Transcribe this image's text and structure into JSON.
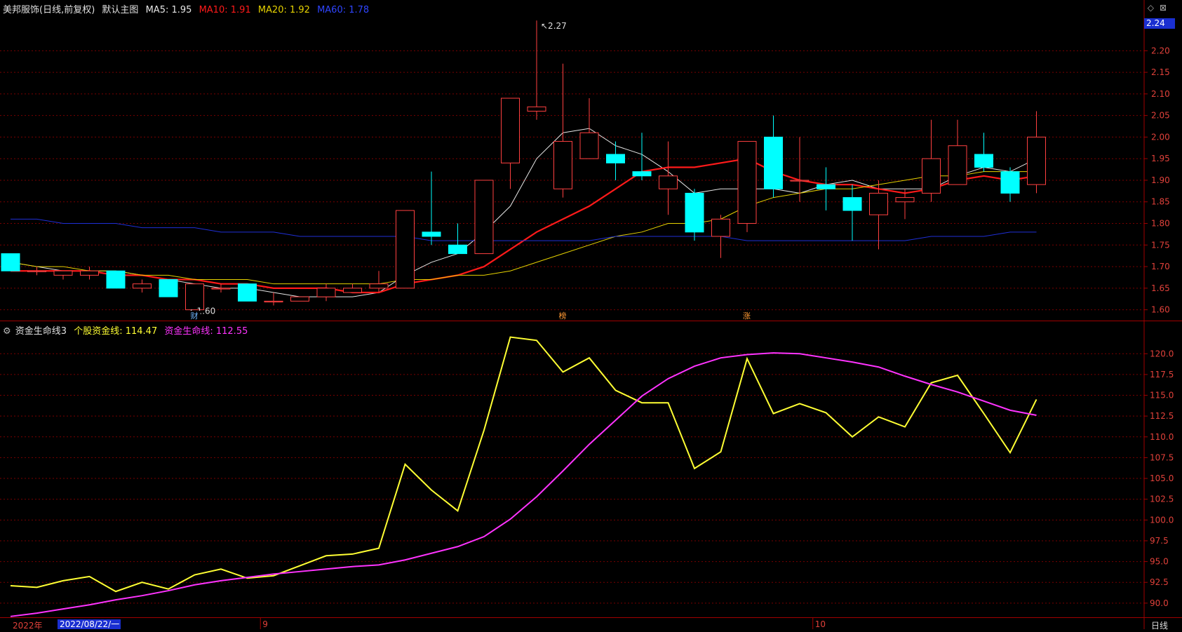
{
  "header": {
    "stock_name": "美邦服饰(日线,前复权)",
    "main_chart_label": "默认主图",
    "ma5_label": "MA5: 1.95",
    "ma10_label": "MA10: 1.91",
    "ma20_label": "MA20: 1.92",
    "ma60_label": "MA60: 1.78"
  },
  "indicator_header": {
    "name": "资金生命线3",
    "line1_label": "个股资金线: 114.47",
    "line2_label": "资金生命线: 112.55"
  },
  "current_price_badge": "2.24",
  "period_label": "日线",
  "date_axis": {
    "year_label": "2022年",
    "cursor_date": "2022/08/22/一",
    "month_labels": [
      {
        "label": "9",
        "index": 10
      },
      {
        "label": "10",
        "index": 31
      }
    ]
  },
  "markers": [
    {
      "text": "财",
      "index": 7
    },
    {
      "text": "榜",
      "index": 21
    },
    {
      "text": "涨",
      "index": 28
    }
  ],
  "annotations": {
    "high_label": "2.27",
    "low_label": "1.60"
  },
  "colors": {
    "up": "#ff4040",
    "down": "#00ffff",
    "ma5": "#e6e6e6",
    "ma10": "#ff1a1a",
    "ma20": "#e6d200",
    "ma60": "#1f2fd6",
    "fund_line": "#ffff33",
    "life_line": "#ff33ff",
    "grid": "#7a0000",
    "axis_text": "#e0413a",
    "border": "#a00000"
  },
  "chart_data": [
    {
      "type": "candlestick",
      "title": "美邦服饰(日线,前复权)",
      "y_ticks": [
        1.6,
        1.65,
        1.7,
        1.75,
        1.8,
        1.85,
        1.9,
        1.95,
        2.0,
        2.05,
        2.1,
        2.15,
        2.2
      ],
      "ylim": [
        1.575,
        2.285
      ],
      "candles": [
        {
          "o": 1.73,
          "h": 1.73,
          "l": 1.69,
          "c": 1.69
        },
        {
          "o": 1.69,
          "h": 1.7,
          "l": 1.68,
          "c": 1.69
        },
        {
          "o": 1.68,
          "h": 1.69,
          "l": 1.67,
          "c": 1.69
        },
        {
          "o": 1.68,
          "h": 1.7,
          "l": 1.67,
          "c": 1.69
        },
        {
          "o": 1.69,
          "h": 1.69,
          "l": 1.65,
          "c": 1.65
        },
        {
          "o": 1.65,
          "h": 1.67,
          "l": 1.64,
          "c": 1.66
        },
        {
          "o": 1.67,
          "h": 1.67,
          "l": 1.63,
          "c": 1.63
        },
        {
          "o": 1.6,
          "h": 1.66,
          "l": 1.6,
          "c": 1.66
        },
        {
          "o": 1.65,
          "h": 1.66,
          "l": 1.64,
          "c": 1.65
        },
        {
          "o": 1.66,
          "h": 1.66,
          "l": 1.62,
          "c": 1.62
        },
        {
          "o": 1.62,
          "h": 1.64,
          "l": 1.61,
          "c": 1.62
        },
        {
          "o": 1.62,
          "h": 1.63,
          "l": 1.62,
          "c": 1.63
        },
        {
          "o": 1.63,
          "h": 1.66,
          "l": 1.62,
          "c": 1.65
        },
        {
          "o": 1.64,
          "h": 1.66,
          "l": 1.64,
          "c": 1.65
        },
        {
          "o": 1.65,
          "h": 1.69,
          "l": 1.64,
          "c": 1.66
        },
        {
          "o": 1.65,
          "h": 1.83,
          "l": 1.65,
          "c": 1.83
        },
        {
          "o": 1.78,
          "h": 1.92,
          "l": 1.75,
          "c": 1.77
        },
        {
          "o": 1.75,
          "h": 1.8,
          "l": 1.73,
          "c": 1.73
        },
        {
          "o": 1.73,
          "h": 1.9,
          "l": 1.73,
          "c": 1.9
        },
        {
          "o": 1.94,
          "h": 2.09,
          "l": 1.88,
          "c": 2.09
        },
        {
          "o": 2.06,
          "h": 2.27,
          "l": 2.04,
          "c": 2.07
        },
        {
          "o": 1.88,
          "h": 2.17,
          "l": 1.86,
          "c": 1.99
        },
        {
          "o": 1.95,
          "h": 2.09,
          "l": 1.95,
          "c": 2.01
        },
        {
          "o": 1.96,
          "h": 1.99,
          "l": 1.9,
          "c": 1.94
        },
        {
          "o": 1.92,
          "h": 2.01,
          "l": 1.9,
          "c": 1.91
        },
        {
          "o": 1.88,
          "h": 1.99,
          "l": 1.82,
          "c": 1.91
        },
        {
          "o": 1.87,
          "h": 1.88,
          "l": 1.76,
          "c": 1.78
        },
        {
          "o": 1.77,
          "h": 1.82,
          "l": 1.72,
          "c": 1.81
        },
        {
          "o": 1.8,
          "h": 1.99,
          "l": 1.78,
          "c": 1.99
        },
        {
          "o": 2.0,
          "h": 2.05,
          "l": 1.86,
          "c": 1.88
        },
        {
          "o": 1.9,
          "h": 2.0,
          "l": 1.85,
          "c": 1.9
        },
        {
          "o": 1.89,
          "h": 1.93,
          "l": 1.83,
          "c": 1.88
        },
        {
          "o": 1.86,
          "h": 1.89,
          "l": 1.76,
          "c": 1.83
        },
        {
          "o": 1.82,
          "h": 1.9,
          "l": 1.74,
          "c": 1.87
        },
        {
          "o": 1.85,
          "h": 1.88,
          "l": 1.81,
          "c": 1.86
        },
        {
          "o": 1.87,
          "h": 2.04,
          "l": 1.85,
          "c": 1.95
        },
        {
          "o": 1.89,
          "h": 2.04,
          "l": 1.89,
          "c": 1.98
        },
        {
          "o": 1.96,
          "h": 2.01,
          "l": 1.92,
          "c": 1.93
        },
        {
          "o": 1.92,
          "h": 1.93,
          "l": 1.85,
          "c": 1.87
        },
        {
          "o": 1.89,
          "h": 2.06,
          "l": 1.87,
          "c": 2.0
        }
      ],
      "series": [
        {
          "name": "MA5",
          "values": [
            1.71,
            1.7,
            1.69,
            1.69,
            1.69,
            1.68,
            1.67,
            1.66,
            1.65,
            1.65,
            1.64,
            1.63,
            1.63,
            1.63,
            1.64,
            1.68,
            1.71,
            1.73,
            1.78,
            1.84,
            1.95,
            2.01,
            2.02,
            1.98,
            1.96,
            1.92,
            1.87,
            1.88,
            1.88,
            1.88,
            1.87,
            1.89,
            1.9,
            1.88,
            1.88,
            1.88,
            1.91,
            1.93,
            1.92,
            1.95
          ]
        },
        {
          "name": "MA10",
          "values": [
            1.69,
            1.69,
            1.69,
            1.69,
            1.68,
            1.68,
            1.67,
            1.67,
            1.66,
            1.66,
            1.65,
            1.65,
            1.65,
            1.64,
            1.64,
            1.66,
            1.67,
            1.68,
            1.7,
            1.74,
            1.78,
            1.81,
            1.84,
            1.88,
            1.92,
            1.93,
            1.93,
            1.94,
            1.95,
            1.92,
            1.9,
            1.89,
            1.89,
            1.88,
            1.87,
            1.88,
            1.9,
            1.91,
            1.9,
            1.91
          ]
        },
        {
          "name": "MA20",
          "values": [
            1.71,
            1.7,
            1.7,
            1.69,
            1.69,
            1.68,
            1.68,
            1.67,
            1.67,
            1.67,
            1.66,
            1.66,
            1.66,
            1.66,
            1.66,
            1.67,
            1.67,
            1.68,
            1.68,
            1.69,
            1.71,
            1.73,
            1.75,
            1.77,
            1.78,
            1.8,
            1.8,
            1.81,
            1.84,
            1.86,
            1.87,
            1.88,
            1.88,
            1.89,
            1.9,
            1.91,
            1.91,
            1.92,
            1.92,
            1.92
          ]
        },
        {
          "name": "MA60",
          "values": [
            1.81,
            1.81,
            1.8,
            1.8,
            1.8,
            1.79,
            1.79,
            1.79,
            1.78,
            1.78,
            1.78,
            1.77,
            1.77,
            1.77,
            1.77,
            1.77,
            1.76,
            1.76,
            1.76,
            1.76,
            1.76,
            1.76,
            1.76,
            1.77,
            1.77,
            1.77,
            1.77,
            1.77,
            1.76,
            1.76,
            1.76,
            1.76,
            1.76,
            1.76,
            1.76,
            1.77,
            1.77,
            1.77,
            1.78,
            1.78
          ]
        }
      ]
    },
    {
      "type": "line",
      "title": "资金生命线3",
      "y_ticks": [
        90.0,
        92.5,
        95.0,
        97.5,
        100.0,
        102.5,
        105.0,
        107.5,
        110.0,
        112.5,
        115.0,
        117.5,
        120.0
      ],
      "ylim": [
        88.3,
        122.3
      ],
      "series": [
        {
          "name": "个股资金线",
          "values": [
            92.1,
            91.9,
            92.7,
            93.2,
            91.4,
            92.5,
            91.7,
            93.4,
            94.1,
            93.0,
            93.3,
            94.5,
            95.7,
            95.9,
            96.6,
            106.7,
            103.6,
            101.1,
            110.8,
            122.0,
            121.6,
            117.8,
            119.5,
            115.6,
            114.1,
            114.1,
            106.2,
            108.2,
            119.4,
            112.8,
            114.0,
            112.9,
            110.0,
            112.4,
            111.2,
            116.5,
            117.4,
            112.8,
            108.1,
            114.5
          ]
        },
        {
          "name": "资金生命线",
          "values": [
            88.4,
            88.8,
            89.3,
            89.8,
            90.4,
            90.9,
            91.5,
            92.2,
            92.7,
            93.1,
            93.5,
            93.8,
            94.1,
            94.4,
            94.6,
            95.2,
            96.0,
            96.8,
            98.0,
            100.1,
            102.8,
            105.9,
            109.1,
            112.0,
            114.9,
            117.0,
            118.5,
            119.5,
            119.9,
            120.1,
            120.0,
            119.5,
            119.0,
            118.4,
            117.3,
            116.3,
            115.4,
            114.3,
            113.2,
            112.6
          ]
        }
      ]
    }
  ]
}
